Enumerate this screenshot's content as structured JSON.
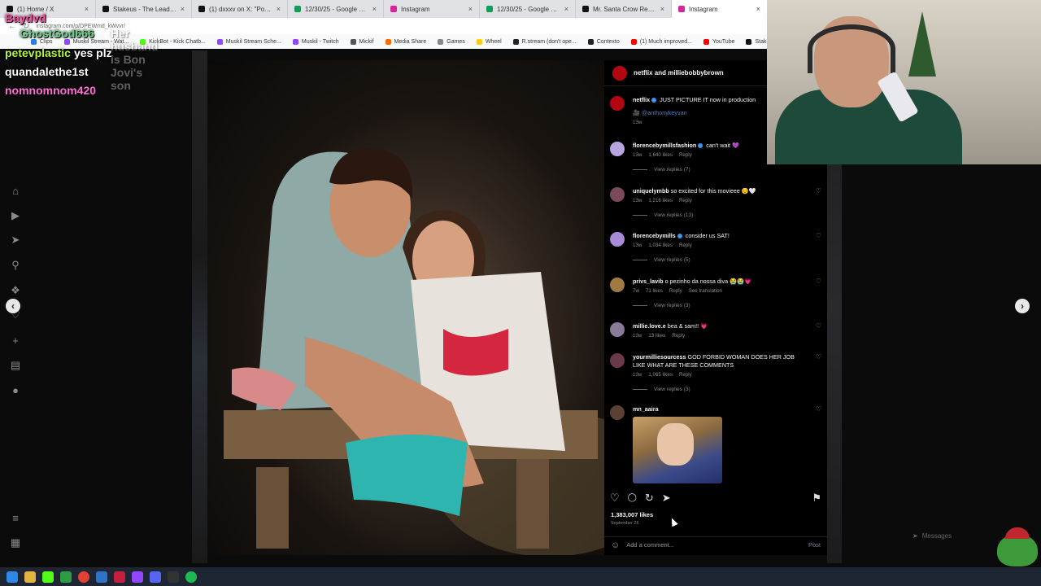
{
  "browser": {
    "tabs": [
      {
        "label": "(1) Home / X",
        "color": "#111111"
      },
      {
        "label": "Stakeus - The Leading Social...",
        "color": "#111111"
      },
      {
        "label": "(1) dxxxv on X: \"Pokimane so...",
        "color": "#111111"
      },
      {
        "label": "12/30/25 - Google Sheets",
        "color": "#0f9d58"
      },
      {
        "label": "Instagram",
        "color": "#d6249f"
      },
      {
        "label": "12/30/25 - Google Sheets",
        "color": "#0f9d58"
      },
      {
        "label": "Mr. Santa Crow Reacts to NEV...",
        "color": "#111111"
      },
      {
        "label": "Instagram",
        "color": "#d6249f"
      }
    ],
    "url": "instagram.com/p/DPEWmd_kWvvr/",
    "bookmarks": [
      {
        "label": "Clips",
        "color": "#2d7be5"
      },
      {
        "label": "Muskil Stream - Wat...",
        "color": "#9146ff"
      },
      {
        "label": "KickBot - Kick Chatb...",
        "color": "#53fc18"
      },
      {
        "label": "Muskil Stream Sche...",
        "color": "#9146ff"
      },
      {
        "label": "Muskil - Twitch",
        "color": "#9146ff"
      },
      {
        "label": "Mickif",
        "color": "#555555"
      },
      {
        "label": "Media Share",
        "color": "#ff6b00"
      },
      {
        "label": "Games",
        "color": "#888888"
      },
      {
        "label": "Wheel",
        "color": "#ffcc00"
      },
      {
        "label": "R.stream (don't ope...",
        "color": "#222222"
      },
      {
        "label": "Contexto",
        "color": "#222222"
      },
      {
        "label": "(1) Much improved...",
        "color": "#ff0000"
      },
      {
        "label": "YouTube",
        "color": "#ff0000"
      },
      {
        "label": "Stakeus - The Lead...",
        "color": "#111111"
      },
      {
        "label": "KickBot Clip Comm...",
        "color": "#53fc18"
      },
      {
        "label": "Kickaway",
        "color": "#53fc18"
      }
    ]
  },
  "chat": {
    "messages": [
      {
        "user": "Baydvd",
        "text": "",
        "color": "#ff4da6"
      },
      {
        "user": "petevplastic",
        "text": "yes plz",
        "color": "#b2f542"
      },
      {
        "user": "quandalethe1st",
        "text": "",
        "color": "#ffffff"
      },
      {
        "user": "nomnomnom420",
        "text": "",
        "color": "#ff6fd8"
      }
    ],
    "ghost_user": "GhostGod666",
    "ghost_text": "Her husband is Bon Jovi's son"
  },
  "post": {
    "header": "netflix and milliebobbybrown",
    "likes": "1,383,007 likes",
    "date": "September 26",
    "comment_placeholder": "Add a comment...",
    "post_label": "Post",
    "comments": [
      {
        "user": "netflix",
        "verified": true,
        "text": "JUST PICTURE IT now in production",
        "mention": "🎥 @anthonykeyvan",
        "age": "13w",
        "likes": "",
        "reply": "",
        "replies": "",
        "avatar": "#b20710"
      },
      {
        "user": "florencebymillsfashion",
        "verified": true,
        "text": "can't wait 💜",
        "age": "13w",
        "likes": "1,640 likes",
        "reply": "Reply",
        "replies": "View replies (7)",
        "avatar": "#b7a5e0"
      },
      {
        "user": "uniquelymbb",
        "verified": false,
        "text": "so excited for this movieee 😊🤍",
        "age": "13w",
        "likes": "1,216 likes",
        "reply": "Reply",
        "replies": "View replies (13)",
        "avatar": "#7a4a5a"
      },
      {
        "user": "florencebymills",
        "verified": true,
        "text": "consider us SAT!",
        "age": "13w",
        "likes": "1,034 likes",
        "reply": "Reply",
        "replies": "View replies (5)",
        "avatar": "#a98bd9"
      },
      {
        "user": "privs_lavib",
        "verified": false,
        "text": "o pezinho da nossa diva 😭😭💗",
        "age": "7w",
        "likes": "71 likes",
        "reply": "Reply",
        "extra": "See translation",
        "replies": "View replies (3)",
        "avatar": "#a07a40"
      },
      {
        "user": "millie.love.e",
        "verified": false,
        "text": "bea & sam!! 💗",
        "age": "13w",
        "likes": "13 likes",
        "reply": "Reply",
        "replies": "",
        "avatar": "#8a7a9a"
      },
      {
        "user": "yourmilliesourcess",
        "verified": false,
        "text": "GOD FORBID WOMAN DOES HER JOB LIKE WHAT ARE THESE COMMENTS",
        "age": "13w",
        "likes": "1,065 likes",
        "reply": "Reply",
        "replies": "View replies (3)",
        "avatar": "#6a3a4a"
      },
      {
        "user": "mn_aaira",
        "verified": false,
        "text": "",
        "age": "",
        "likes": "",
        "reply": "",
        "replies": "",
        "avatar": "#5a4035"
      }
    ]
  },
  "overlay": {
    "messages_label": "Messages"
  },
  "icons": {
    "prev_arrow": "‹",
    "next_arrow": "›",
    "heart": "♡",
    "comment": "◯",
    "repost": "↻",
    "share": "➤",
    "bookmark": "⚑",
    "emoji": "☺"
  }
}
